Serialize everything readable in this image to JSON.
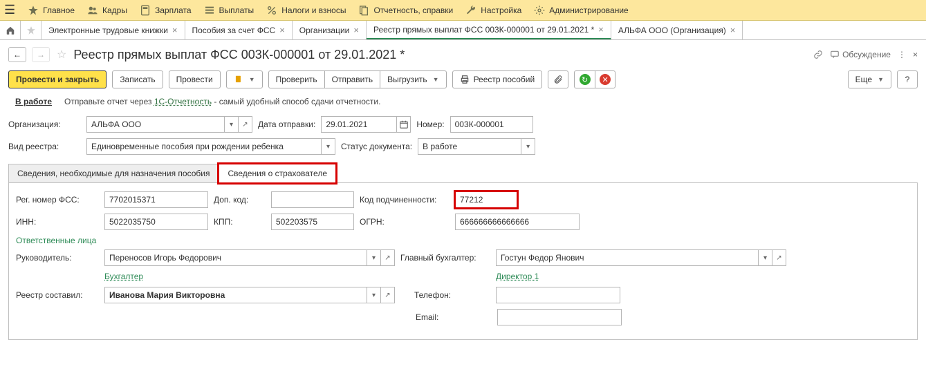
{
  "topbar": {
    "items": [
      {
        "icon": "star",
        "label": "Главное"
      },
      {
        "icon": "people",
        "label": "Кадры"
      },
      {
        "icon": "calc",
        "label": "Зарплата"
      },
      {
        "icon": "list",
        "label": "Выплаты"
      },
      {
        "icon": "percent",
        "label": "Налоги и взносы"
      },
      {
        "icon": "report",
        "label": "Отчетность, справки"
      },
      {
        "icon": "wrench",
        "label": "Настройка"
      },
      {
        "icon": "gear",
        "label": "Администрирование"
      }
    ]
  },
  "tabs": [
    {
      "label": "Электронные трудовые книжки",
      "active": false
    },
    {
      "label": "Пособия за счет ФСС",
      "active": false
    },
    {
      "label": "Организации",
      "active": false
    },
    {
      "label": "Реестр прямых выплат ФСС 003К-000001 от 29.01.2021 *",
      "active": true
    },
    {
      "label": "АЛЬФА ООО (Организация)",
      "active": false
    }
  ],
  "title": "Реестр прямых выплат ФСС 003К-000001 от 29.01.2021 *",
  "discuss": "Обсуждение",
  "toolbar": {
    "primary": "Провести и закрыть",
    "save": "Записать",
    "post": "Провести",
    "check": "Проверить",
    "send": "Отправить",
    "export": "Выгрузить",
    "registry": "Реестр пособий",
    "more": "Еще"
  },
  "status": {
    "state": "В работе",
    "hint_before": "Отправьте отчет через ",
    "hint_link": "1С-Отчетность",
    "hint_after": " - самый удобный способ сдачи отчетности."
  },
  "form": {
    "org_lbl": "Организация:",
    "org_val": "АЛЬФА ООО",
    "date_lbl": "Дата отправки:",
    "date_val": "29.01.2021",
    "num_lbl": "Номер:",
    "num_val": "003К-000001",
    "kind_lbl": "Вид реестра:",
    "kind_val": "Единовременные пособия при рождении ребенка",
    "docstatus_lbl": "Статус документа:",
    "docstatus_val": "В работе"
  },
  "innertabs": {
    "t1": "Сведения, необходимые для назначения пособия",
    "t2": "Сведения о страхователе"
  },
  "panel": {
    "reg_lbl": "Рег. номер ФСС:",
    "reg_val": "7702015371",
    "dop_lbl": "Доп. код:",
    "dop_val": "",
    "sub_lbl": "Код подчиненности:",
    "sub_val": "77212",
    "inn_lbl": "ИНН:",
    "inn_val": "5022035750",
    "kpp_lbl": "КПП:",
    "kpp_val": "502203575",
    "ogrn_lbl": "ОГРН:",
    "ogrn_val": "666666666666666",
    "resp_title": "Ответственные лица",
    "head_lbl": "Руководитель:",
    "head_val": "Переносов Игорь Федорович",
    "acct_lbl": "Главный бухгалтер:",
    "acct_val": "Гостун Федор Янович",
    "link_buh": "Бухгалтер ",
    "link_dir": "Директор 1 ",
    "author_lbl": "Реестр составил:",
    "author_val": "Иванова Мария Викторовна",
    "phone_lbl": "Телефон:",
    "phone_val": "",
    "email_lbl": "Email:",
    "email_val": ""
  }
}
